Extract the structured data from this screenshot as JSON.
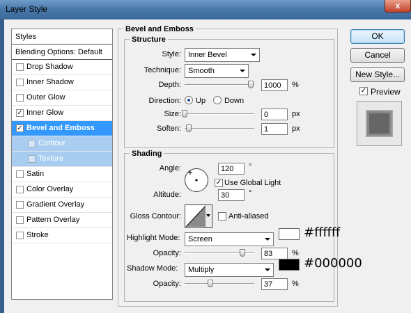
{
  "window": {
    "title": "Layer Style",
    "close_label": "x"
  },
  "styles_panel": {
    "header": "Styles",
    "blending_options": "Blending Options: Default",
    "items": [
      {
        "label": "Drop Shadow",
        "checked": false
      },
      {
        "label": "Inner Shadow",
        "checked": false
      },
      {
        "label": "Outer Glow",
        "checked": false
      },
      {
        "label": "Inner Glow",
        "checked": true
      },
      {
        "label": "Bevel and Emboss",
        "checked": true,
        "selected": true
      },
      {
        "label": "Contour",
        "checked": false,
        "sub": true
      },
      {
        "label": "Texture",
        "checked": false,
        "sub": true
      },
      {
        "label": "Satin",
        "checked": false
      },
      {
        "label": "Color Overlay",
        "checked": false
      },
      {
        "label": "Gradient Overlay",
        "checked": false
      },
      {
        "label": "Pattern Overlay",
        "checked": false
      },
      {
        "label": "Stroke",
        "checked": false
      }
    ]
  },
  "bevel": {
    "section_title": "Bevel and Emboss",
    "structure": {
      "title": "Structure",
      "style_label": "Style:",
      "style_value": "Inner Bevel",
      "technique_label": "Technique:",
      "technique_value": "Smooth",
      "depth_label": "Depth:",
      "depth_value": "1000",
      "depth_unit": "%",
      "depth_level": 0.95,
      "direction_label": "Direction:",
      "direction_up": "Up",
      "direction_down": "Down",
      "direction_selected": "Up",
      "size_label": "Size:",
      "size_value": "0",
      "size_unit": "px",
      "size_level": 0.0,
      "soften_label": "Soften:",
      "soften_value": "1",
      "soften_unit": "px",
      "soften_level": 0.06
    },
    "shading": {
      "title": "Shading",
      "angle_label": "Angle:",
      "angle_value": "120",
      "angle_unit": "°",
      "use_global_light": "Use Global Light",
      "use_global_light_checked": true,
      "altitude_label": "Altitude:",
      "altitude_value": "30",
      "altitude_unit": "°",
      "gloss_contour_label": "Gloss Contour:",
      "anti_aliased": "Anti-aliased",
      "anti_aliased_checked": false,
      "highlight_mode_label": "Highlight Mode:",
      "highlight_mode_value": "Screen",
      "highlight_color": "#ffffff",
      "highlight_hex": "#ffffff",
      "highlight_opacity_label": "Opacity:",
      "highlight_opacity_value": "83",
      "highlight_opacity_unit": "%",
      "highlight_opacity_level": 0.83,
      "shadow_mode_label": "Shadow Mode:",
      "shadow_mode_value": "Multiply",
      "shadow_color": "#000000",
      "shadow_hex": "#000000",
      "shadow_opacity_label": "Opacity:",
      "shadow_opacity_value": "37",
      "shadow_opacity_unit": "%",
      "shadow_opacity_level": 0.37
    }
  },
  "buttons": {
    "ok": "OK",
    "cancel": "Cancel",
    "new_style": "New Style...",
    "preview": "Preview",
    "preview_checked": true
  },
  "colors": {
    "selection": "#3399ff",
    "sub_selection": "#a8cdf0",
    "title_bar": "#4a79ab"
  }
}
